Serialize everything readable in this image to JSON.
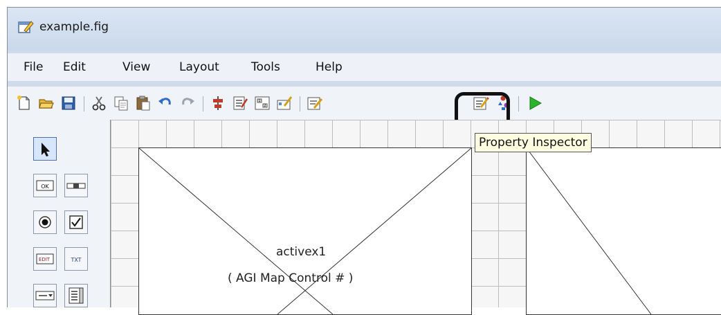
{
  "window": {
    "title": "example.fig"
  },
  "menu": {
    "items": [
      {
        "label": "File"
      },
      {
        "label": "Edit"
      },
      {
        "label": "View"
      },
      {
        "label": "Layout"
      },
      {
        "label": "Tools"
      },
      {
        "label": "Help"
      }
    ]
  },
  "toolbar": {
    "icons": [
      "new-icon",
      "open-icon",
      "save-icon",
      "cut-icon",
      "copy-icon",
      "paste-icon",
      "undo-icon",
      "redo-icon",
      "align-icon",
      "menu-editor-icon",
      "tab-order-icon",
      "toolbar-editor-icon",
      "mfile-editor-icon",
      "property-inspector-icon",
      "object-browser-icon",
      "run-icon"
    ],
    "highlighted": "property-inspector-icon"
  },
  "tooltip": {
    "text": "Property Inspector"
  },
  "palette": {
    "tools": [
      {
        "name": "select-tool",
        "glyph": ""
      },
      {
        "name": "push-button-tool",
        "glyph": "OK"
      },
      {
        "name": "slider-tool",
        "glyph": ""
      },
      {
        "name": "radio-button-tool",
        "glyph": ""
      },
      {
        "name": "checkbox-tool",
        "glyph": "☑"
      },
      {
        "name": "edit-text-tool",
        "glyph": "EDIT"
      },
      {
        "name": "static-text-tool",
        "glyph": "TXT"
      },
      {
        "name": "popup-menu-tool",
        "glyph": ""
      },
      {
        "name": "listbox-tool",
        "glyph": ""
      }
    ]
  },
  "canvas": {
    "components": [
      {
        "name": "activex1",
        "line1": "activex1",
        "line2": "( AGI Map Control # )"
      }
    ]
  },
  "colors": {
    "window_bg": "#cfdbe9",
    "run_green": "#2db32d",
    "tooltip_bg": "#ffffe1"
  }
}
